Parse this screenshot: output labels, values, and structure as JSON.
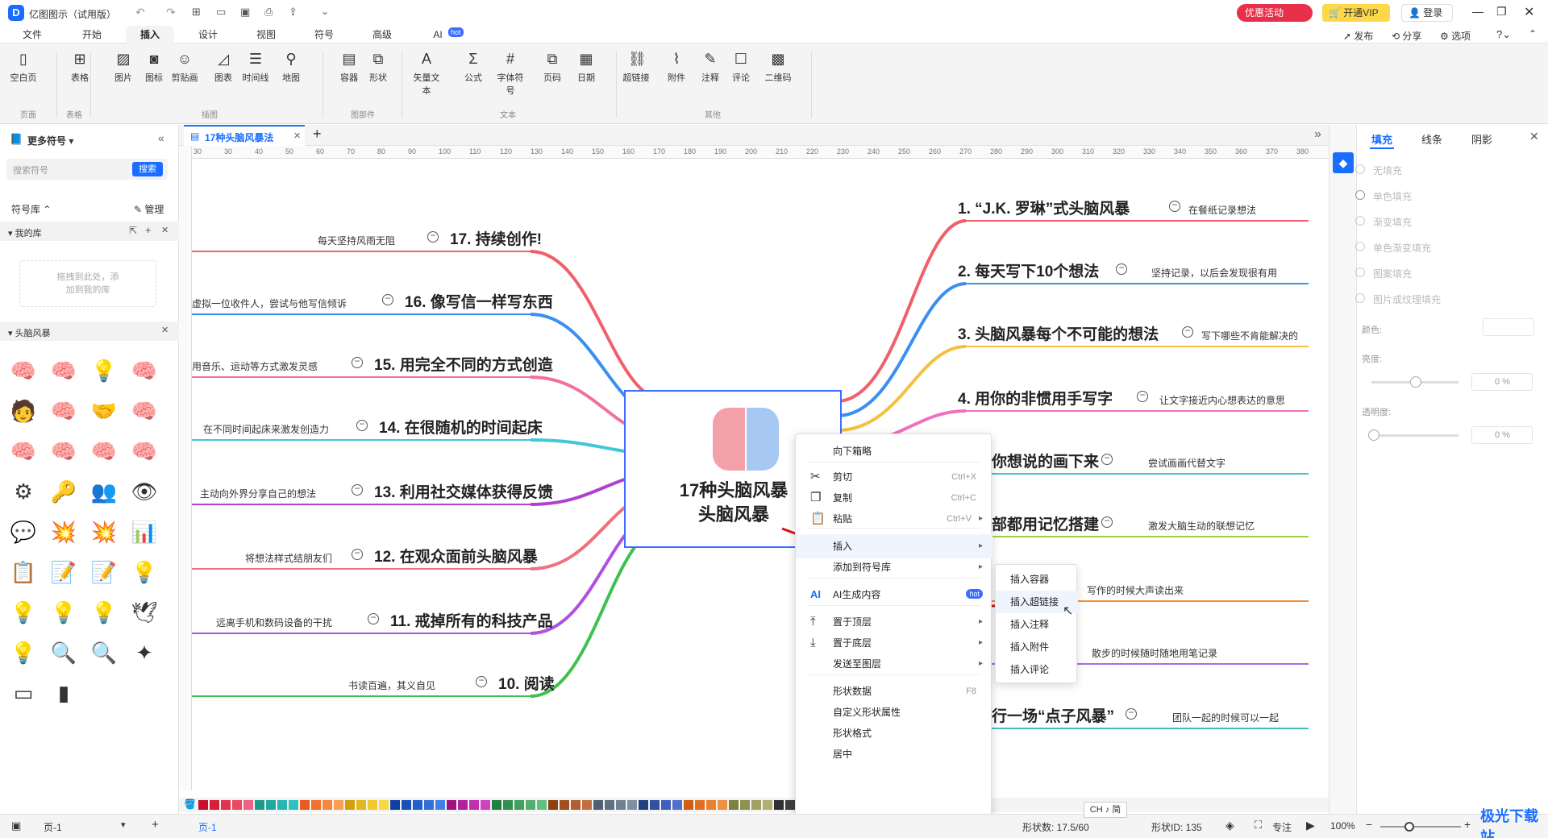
{
  "app": {
    "title": "亿图图示（试用版）",
    "promo": "优惠活动",
    "vip": "开通VIP",
    "login": "登录"
  },
  "menu": {
    "tabs": [
      "文件",
      "开始",
      "插入",
      "设计",
      "视图",
      "符号",
      "高级",
      "AI"
    ],
    "ai_badge": "hot",
    "active": "插入",
    "right": [
      "发布",
      "分享",
      "选项"
    ]
  },
  "ribbon": {
    "buttons": [
      "空白页",
      "表格",
      "图片",
      "图标",
      "剪贴画",
      "图表",
      "时间线",
      "地图",
      "容器",
      "形状",
      "矢量文本",
      "公式",
      "字体符号",
      "页码",
      "日期",
      "超链接",
      "附件",
      "注释",
      "评论",
      "二维码"
    ],
    "icons": [
      "page-icon",
      "table-icon",
      "image-icon",
      "icon-icon",
      "clipart-icon",
      "chart-icon",
      "timeline-icon",
      "map-icon",
      "container-icon",
      "shape-icon",
      "vector-text-icon",
      "formula-icon",
      "font-symbol-icon",
      "page-number-icon",
      "date-icon",
      "hyperlink-icon",
      "attachment-icon",
      "note-icon",
      "comment-icon",
      "qrcode-icon"
    ],
    "groups": [
      "页面",
      "表格",
      "插图",
      "图部件",
      "文本",
      "其他"
    ]
  },
  "left": {
    "title": "更多符号",
    "search_placeholder": "搜索符号",
    "search_btn": "搜索",
    "lib_label": "符号库",
    "manage": "管理",
    "my_lib": "我的库",
    "drop_hint_1": "拖拽到此处，添",
    "drop_hint_2": "加到我的库",
    "category": "头脑风暴"
  },
  "doc_tab": "17种头脑风暴法",
  "ruler": [
    "30",
    "30",
    "40",
    "50",
    "60",
    "70",
    "80",
    "90",
    "100",
    "110",
    "120",
    "130",
    "140",
    "150",
    "160",
    "170",
    "180",
    "190",
    "200",
    "210",
    "220",
    "230",
    "240",
    "250",
    "260",
    "270",
    "280",
    "290",
    "300",
    "310",
    "320",
    "330",
    "340",
    "350",
    "360",
    "370",
    "380"
  ],
  "mindmap": {
    "center": [
      "17种头脑风暴",
      "头脑风暴"
    ],
    "right": [
      {
        "topic": "1. “J.K. 罗琳”式头脑风暴",
        "note": "在餐纸记录想法",
        "color": "#f0606a"
      },
      {
        "topic": "2. 每天写下10个想法",
        "note": "坚持记录，以后会发现很有用",
        "color": "#3b8ff0"
      },
      {
        "topic": "3. 头脑风暴每个不可能的想法",
        "note": "写下哪些不肯能解决的",
        "color": "#f5c040"
      },
      {
        "topic": "4. 用你的非惯用手写字",
        "note": "让文字接近内心想表达的意思",
        "color": "#f070c0"
      },
      {
        "topic": "你想说的画下来",
        "note": "尝试画画代替文字",
        "color": "#4cc0d0"
      },
      {
        "topic": "部都用记忆搭建",
        "note": "激发大脑生动的联想记忆",
        "color": "#a0d040"
      },
      {
        "topic": "",
        "note": "写作的时候大声读出来",
        "color": "#f09040"
      },
      {
        "topic": "",
        "note": "散步的时候随时随地用笔记录",
        "color": "#a070e0"
      },
      {
        "topic": "行一场“点子风暴”",
        "note": "团队一起的时候可以一起",
        "color": "#40c0c0"
      }
    ],
    "left": [
      {
        "topic": "17. 持续创作!",
        "note": "每天坚持风雨无阻",
        "color": "#f0606a"
      },
      {
        "topic": "16. 像写信一样写东西",
        "note": "虚拟一位收件人，尝试与他写信倾诉",
        "color": "#3b8ff0"
      },
      {
        "topic": "15. 用完全不同的方式创造",
        "note": "用音乐、运动等方式激发灵感",
        "color": "#f070a0"
      },
      {
        "topic": "14. 在很随机的时间起床",
        "note": "在不同时间起床来激发创造力",
        "color": "#40c8d8"
      },
      {
        "topic": "13. 利用社交媒体获得反馈",
        "note": "主动向外界分享自己的想法",
        "color": "#b040d0"
      },
      {
        "topic": "12. 在观众面前头脑风暴",
        "note": "将想法样式结朋友们",
        "color": "#f07080"
      },
      {
        "topic": "11. 戒掉所有的科技产品",
        "note": "远离手机和数码设备的干扰",
        "color": "#b050e0"
      },
      {
        "topic": "10. 阅读",
        "note": "书读百遍，其义自见",
        "color": "#40c050"
      }
    ]
  },
  "context_menu": {
    "items": [
      {
        "label": "向下箱略",
        "shortcut": "",
        "icon": ""
      },
      {
        "label": "剪切",
        "shortcut": "Ctrl+X",
        "icon": "cut-icon"
      },
      {
        "label": "复制",
        "shortcut": "Ctrl+C",
        "icon": "copy-icon"
      },
      {
        "label": "粘贴",
        "shortcut": "Ctrl+V",
        "icon": "paste-icon"
      },
      {
        "label": "插入",
        "shortcut": "",
        "icon": ""
      },
      {
        "label": "添加到符号库",
        "shortcut": "",
        "icon": ""
      },
      {
        "label": "AI生成内容",
        "shortcut": "",
        "icon": "ai-icon"
      },
      {
        "label": "置于顶层",
        "shortcut": "",
        "icon": "bring-front-icon"
      },
      {
        "label": "置于底层",
        "shortcut": "",
        "icon": "send-back-icon"
      },
      {
        "label": "发送至图层",
        "shortcut": "",
        "icon": ""
      },
      {
        "label": "形状数据",
        "shortcut": "F8",
        "icon": ""
      },
      {
        "label": "自定义形状属性",
        "shortcut": "",
        "icon": ""
      },
      {
        "label": "形状格式",
        "shortcut": "",
        "icon": ""
      },
      {
        "label": "居中",
        "shortcut": "",
        "icon": ""
      }
    ],
    "ai_badge": "hot"
  },
  "submenu": [
    "插入容器",
    "插入超链接",
    "插入注释",
    "插入附件",
    "插入评论"
  ],
  "right_panel": {
    "tabs": [
      "填充",
      "线条",
      "阴影"
    ],
    "fill_options": [
      "无填充",
      "单色填充",
      "渐变填充",
      "单色渐变填充",
      "图案填充",
      "图片或纹理填充"
    ],
    "color_label": "颜色:",
    "brightness_label": "亮度:",
    "transparency_label": "透明度:",
    "brightness_value": "0 %",
    "transparency_value": "0 %"
  },
  "status": {
    "page": "页-1",
    "page_tab": "页-1",
    "shape_count": "形状数: 17.5/60",
    "shape_id": "形状ID: 135",
    "focus": "专注",
    "zoom": "100%",
    "ime": "CH ♪ 简"
  },
  "watermark": "极光下载站",
  "palette": [
    "#c8102e",
    "#d81e3a",
    "#e0344c",
    "#e84a60",
    "#f06080",
    "#1a9c8c",
    "#20a8a0",
    "#28b4b4",
    "#30c0c0",
    "#e85a20",
    "#f07030",
    "#f48840",
    "#f8a050",
    "#d0a010",
    "#e0b820",
    "#f0c830",
    "#f8d840",
    "#1040a0",
    "#1850b8",
    "#2060c8",
    "#3070d8",
    "#4080e8",
    "#a01080",
    "#b020a0",
    "#c030b0",
    "#d040c0",
    "#208040",
    "#309050",
    "#40a060",
    "#50b070",
    "#60c080",
    "#904010",
    "#a05020",
    "#b06030",
    "#c07040",
    "#506070",
    "#607080",
    "#708090",
    "#8090a0",
    "#204080",
    "#3050a0",
    "#4060c0",
    "#5070d0",
    "#d06010",
    "#e07020",
    "#e88030",
    "#f09040",
    "#808040",
    "#909050",
    "#a0a060",
    "#b0b070",
    "#303030",
    "#404040",
    "#505050",
    "#606060",
    "#707070",
    "#808080",
    "#909090",
    "#a0a0a0",
    "#b0b0b0",
    "#c0c0c0",
    "#d0d0d0",
    "#e0e0e0",
    "#f0f0f0",
    "#ffffff"
  ]
}
